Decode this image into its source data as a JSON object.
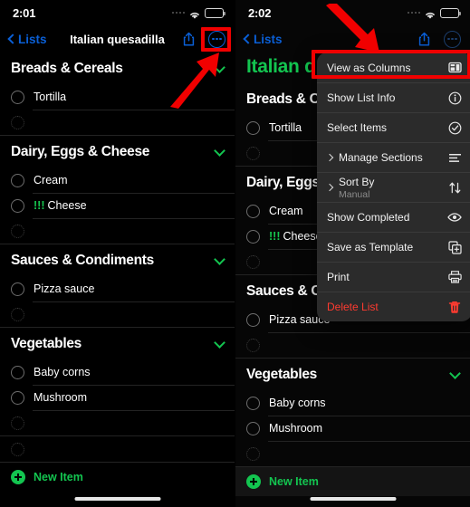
{
  "colors": {
    "accent_green": "#13c550",
    "link_blue": "#0a5fd6",
    "danger_red": "#ff3b30",
    "annotation_red": "#f10000",
    "menu_bg": "#2b2b2b"
  },
  "panels": [
    {
      "id": "left",
      "status": {
        "time": "2:01",
        "cellular": "cellular-dots-icon",
        "wifi": "wifi-icon",
        "battery": "battery-icon"
      },
      "nav": {
        "back_label": "Lists",
        "title": "Italian quesadilla",
        "share": "share-icon",
        "more": "ellipsis-circle-icon"
      },
      "big_title": null,
      "sections": [
        {
          "title": "Breads & Cereals",
          "collapse": "chevron-down-icon",
          "rows": [
            {
              "label": "Tortilla",
              "priority": ""
            },
            {
              "label": "",
              "placeholder": true
            }
          ]
        },
        {
          "title": "Dairy, Eggs & Cheese",
          "collapse": "chevron-down-icon",
          "rows": [
            {
              "label": "Cream",
              "priority": ""
            },
            {
              "label": "Cheese",
              "priority": "!!!"
            },
            {
              "label": "",
              "placeholder": true
            }
          ]
        },
        {
          "title": "Sauces & Condiments",
          "collapse": "chevron-down-icon",
          "rows": [
            {
              "label": "Pizza sauce",
              "priority": ""
            },
            {
              "label": "",
              "placeholder": true
            }
          ]
        },
        {
          "title": "Vegetables",
          "collapse": "chevron-down-icon",
          "rows": [
            {
              "label": "Baby corns",
              "priority": ""
            },
            {
              "label": "Mushroom",
              "priority": ""
            },
            {
              "label": "",
              "placeholder": true
            }
          ]
        }
      ],
      "trailing_row": {
        "label": "",
        "placeholder": true
      },
      "new_item_label": "New Item",
      "menu_open": false
    },
    {
      "id": "right",
      "status": {
        "time": "2:02",
        "cellular": "cellular-dots-icon",
        "wifi": "wifi-icon",
        "battery": "battery-icon"
      },
      "nav": {
        "back_label": "Lists",
        "title": "",
        "share": "share-icon",
        "more": "ellipsis-circle-icon"
      },
      "big_title": "Italian q",
      "sections": [
        {
          "title": "Breads & Ce",
          "collapse": "chevron-down-icon",
          "rows": [
            {
              "label": "Tortilla",
              "priority": ""
            },
            {
              "label": "",
              "placeholder": true
            }
          ]
        },
        {
          "title": "Dairy, Eggs",
          "collapse": "chevron-down-icon",
          "rows": [
            {
              "label": "Cream",
              "priority": ""
            },
            {
              "label": "Cheese",
              "priority": "!!!"
            },
            {
              "label": "",
              "placeholder": true
            }
          ]
        },
        {
          "title": "Sauces & C",
          "collapse": "chevron-down-icon",
          "rows": [
            {
              "label": "Pizza sauce",
              "priority": ""
            },
            {
              "label": "",
              "placeholder": true
            }
          ]
        },
        {
          "title": "Vegetables",
          "collapse": "chevron-down-icon",
          "rows": [
            {
              "label": "Baby corns",
              "priority": ""
            },
            {
              "label": "Mushroom",
              "priority": ""
            },
            {
              "label": "",
              "placeholder": true
            }
          ]
        }
      ],
      "trailing_row": null,
      "new_item_label": "New Item",
      "menu_open": true
    }
  ],
  "menu": {
    "items": [
      {
        "label": "View as Columns",
        "sub": "",
        "icon": "columns-icon",
        "submenu": false,
        "danger": false,
        "highlighted": true
      },
      {
        "label": "Show List Info",
        "sub": "",
        "icon": "info-circle-icon",
        "submenu": false,
        "danger": false,
        "highlighted": false
      },
      {
        "label": "Select Items",
        "sub": "",
        "icon": "checkmark-circle-icon",
        "submenu": false,
        "danger": false,
        "highlighted": false
      },
      {
        "label": "Manage Sections",
        "sub": "",
        "icon": "list-bullet-icon",
        "submenu": true,
        "danger": false,
        "highlighted": false
      },
      {
        "label": "Sort By",
        "sub": "Manual",
        "icon": "sort-arrows-icon",
        "submenu": true,
        "danger": false,
        "highlighted": false
      },
      {
        "label": "Show Completed",
        "sub": "",
        "icon": "eye-icon",
        "submenu": false,
        "danger": false,
        "highlighted": false
      },
      {
        "label": "Save as Template",
        "sub": "",
        "icon": "duplicate-icon",
        "submenu": false,
        "danger": false,
        "highlighted": false
      },
      {
        "label": "Print",
        "sub": "",
        "icon": "printer-icon",
        "submenu": false,
        "danger": false,
        "highlighted": false
      },
      {
        "label": "Delete List",
        "sub": "",
        "icon": "trash-icon",
        "submenu": false,
        "danger": true,
        "highlighted": false
      }
    ]
  },
  "annotations": {
    "left_highlight": "ellipsis-more-button-highlight",
    "left_arrow": "arrow-pointing-to-more-button",
    "right_highlight": "view-as-columns-highlight",
    "right_arrow": "arrow-pointing-to-view-as-columns"
  }
}
